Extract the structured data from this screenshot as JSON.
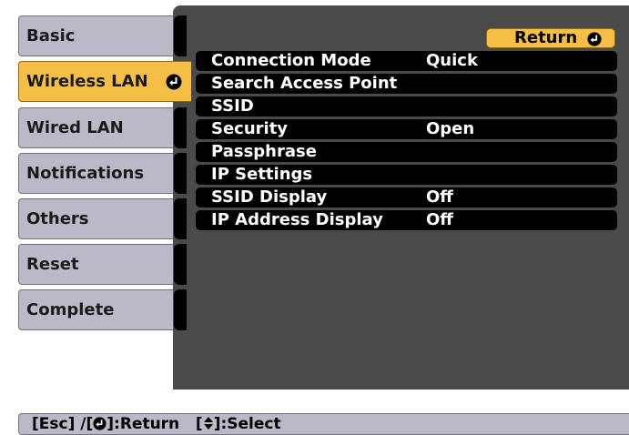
{
  "tabs": [
    {
      "label": "Basic"
    },
    {
      "label": "Wireless LAN",
      "active": true,
      "icon": "enter-icon"
    },
    {
      "label": "Wired LAN"
    },
    {
      "label": "Notifications"
    },
    {
      "label": "Others"
    },
    {
      "label": "Reset"
    },
    {
      "label": "Complete"
    }
  ],
  "panel": {
    "return_label": "Return",
    "return_icon": "enter-icon",
    "rows": [
      {
        "label": "Connection Mode",
        "value": "Quick"
      },
      {
        "label": "Search Access Point",
        "value": ""
      },
      {
        "label": "SSID",
        "value": ""
      },
      {
        "label": "Security",
        "value": "Open"
      },
      {
        "label": "Passphrase",
        "value": ""
      },
      {
        "label": "IP Settings",
        "value": ""
      },
      {
        "label": "SSID Display",
        "value": "Off"
      },
      {
        "label": "IP Address Display",
        "value": "Off"
      }
    ]
  },
  "hint": {
    "esc": "[Esc] /[",
    "return_text": "]:Return",
    "select_open": "[",
    "select_text": "]:Select"
  },
  "colors": {
    "active_tab": "#f4bf44",
    "inactive_tab": "#b9b9c7",
    "panel": "#4a4a4a",
    "row": "#000000",
    "row_text": "#ffffff"
  }
}
